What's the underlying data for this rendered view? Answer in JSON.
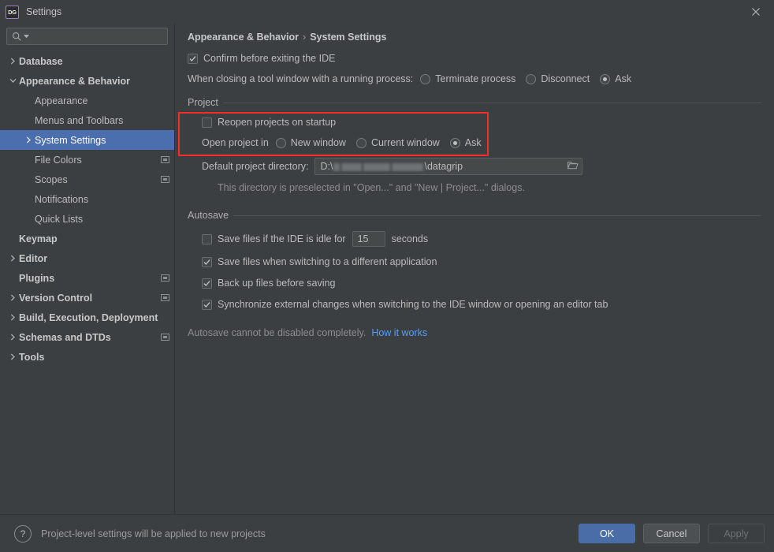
{
  "window": {
    "app_icon_text": "DG",
    "title": "Settings",
    "close_icon": "close-icon"
  },
  "sidebar": {
    "search": {
      "value": "",
      "placeholder": "",
      "icon": "search-icon"
    },
    "items": [
      {
        "label": "Database",
        "arrow": "right",
        "indent": 0,
        "bold": true,
        "selected": false,
        "badge": false
      },
      {
        "label": "Appearance & Behavior",
        "arrow": "down",
        "indent": 0,
        "bold": true,
        "selected": false,
        "badge": false
      },
      {
        "label": "Appearance",
        "arrow": "none",
        "indent": 1,
        "bold": false,
        "selected": false,
        "badge": false
      },
      {
        "label": "Menus and Toolbars",
        "arrow": "none",
        "indent": 1,
        "bold": false,
        "selected": false,
        "badge": false
      },
      {
        "label": "System Settings",
        "arrow": "right",
        "indent": 1,
        "bold": false,
        "selected": true,
        "badge": false
      },
      {
        "label": "File Colors",
        "arrow": "none",
        "indent": 1,
        "bold": false,
        "selected": false,
        "badge": true
      },
      {
        "label": "Scopes",
        "arrow": "none",
        "indent": 1,
        "bold": false,
        "selected": false,
        "badge": true
      },
      {
        "label": "Notifications",
        "arrow": "none",
        "indent": 1,
        "bold": false,
        "selected": false,
        "badge": false
      },
      {
        "label": "Quick Lists",
        "arrow": "none",
        "indent": 1,
        "bold": false,
        "selected": false,
        "badge": false
      },
      {
        "label": "Keymap",
        "arrow": "none",
        "indent": 0,
        "bold": true,
        "selected": false,
        "badge": false
      },
      {
        "label": "Editor",
        "arrow": "right",
        "indent": 0,
        "bold": true,
        "selected": false,
        "badge": false
      },
      {
        "label": "Plugins",
        "arrow": "none",
        "indent": 0,
        "bold": true,
        "selected": false,
        "badge": true
      },
      {
        "label": "Version Control",
        "arrow": "right",
        "indent": 0,
        "bold": true,
        "selected": false,
        "badge": true
      },
      {
        "label": "Build, Execution, Deployment",
        "arrow": "right",
        "indent": 0,
        "bold": true,
        "selected": false,
        "badge": false
      },
      {
        "label": "Schemas and DTDs",
        "arrow": "right",
        "indent": 0,
        "bold": true,
        "selected": false,
        "badge": true
      },
      {
        "label": "Tools",
        "arrow": "right",
        "indent": 0,
        "bold": true,
        "selected": false,
        "badge": false
      }
    ]
  },
  "breadcrumb": {
    "parent": "Appearance & Behavior",
    "separator": "›",
    "current": "System Settings"
  },
  "main": {
    "confirm_exit": {
      "label": "Confirm before exiting the IDE",
      "checked": true
    },
    "closing_tool_window": {
      "label": "When closing a tool window with a running process:",
      "options": [
        {
          "label": "Terminate process",
          "selected": false
        },
        {
          "label": "Disconnect",
          "selected": false
        },
        {
          "label": "Ask",
          "selected": true
        }
      ]
    },
    "project_group": {
      "title": "Project",
      "reopen": {
        "label": "Reopen projects on startup",
        "checked": false
      },
      "open_project_in": {
        "label": "Open project in",
        "options": [
          {
            "label": "New window",
            "selected": false
          },
          {
            "label": "Current window",
            "selected": false
          },
          {
            "label": "Ask",
            "selected": true
          }
        ]
      },
      "default_dir": {
        "label": "Default project directory:",
        "value_prefix": "D:\\",
        "value_suffix": "\\datagrip",
        "redacted": true,
        "browse_icon": "folder-icon"
      },
      "dir_hint": "This directory is preselected in \"Open...\" and \"New | Project...\" dialogs."
    },
    "autosave_group": {
      "title": "Autosave",
      "idle": {
        "label_before": "Save files if the IDE is idle for",
        "value": "15",
        "label_after": "seconds",
        "checked": false
      },
      "switch_app": {
        "label": "Save files when switching to a different application",
        "checked": true
      },
      "backup": {
        "label": "Back up files before saving",
        "checked": true
      },
      "sync": {
        "label": "Synchronize external changes when switching to the IDE window or opening an editor tab",
        "checked": true
      },
      "note": "Autosave cannot be disabled completely.",
      "note_link": "How it works"
    }
  },
  "footer": {
    "help_icon": "?",
    "note": "Project-level settings will be applied to new projects",
    "ok": "OK",
    "cancel": "Cancel",
    "apply": "Apply"
  },
  "colors": {
    "background": "#3c3f41",
    "selection": "#4b6eaf",
    "highlight_box": "#f92a2a",
    "primary_button": "#4a6da7",
    "link": "#589df6"
  }
}
